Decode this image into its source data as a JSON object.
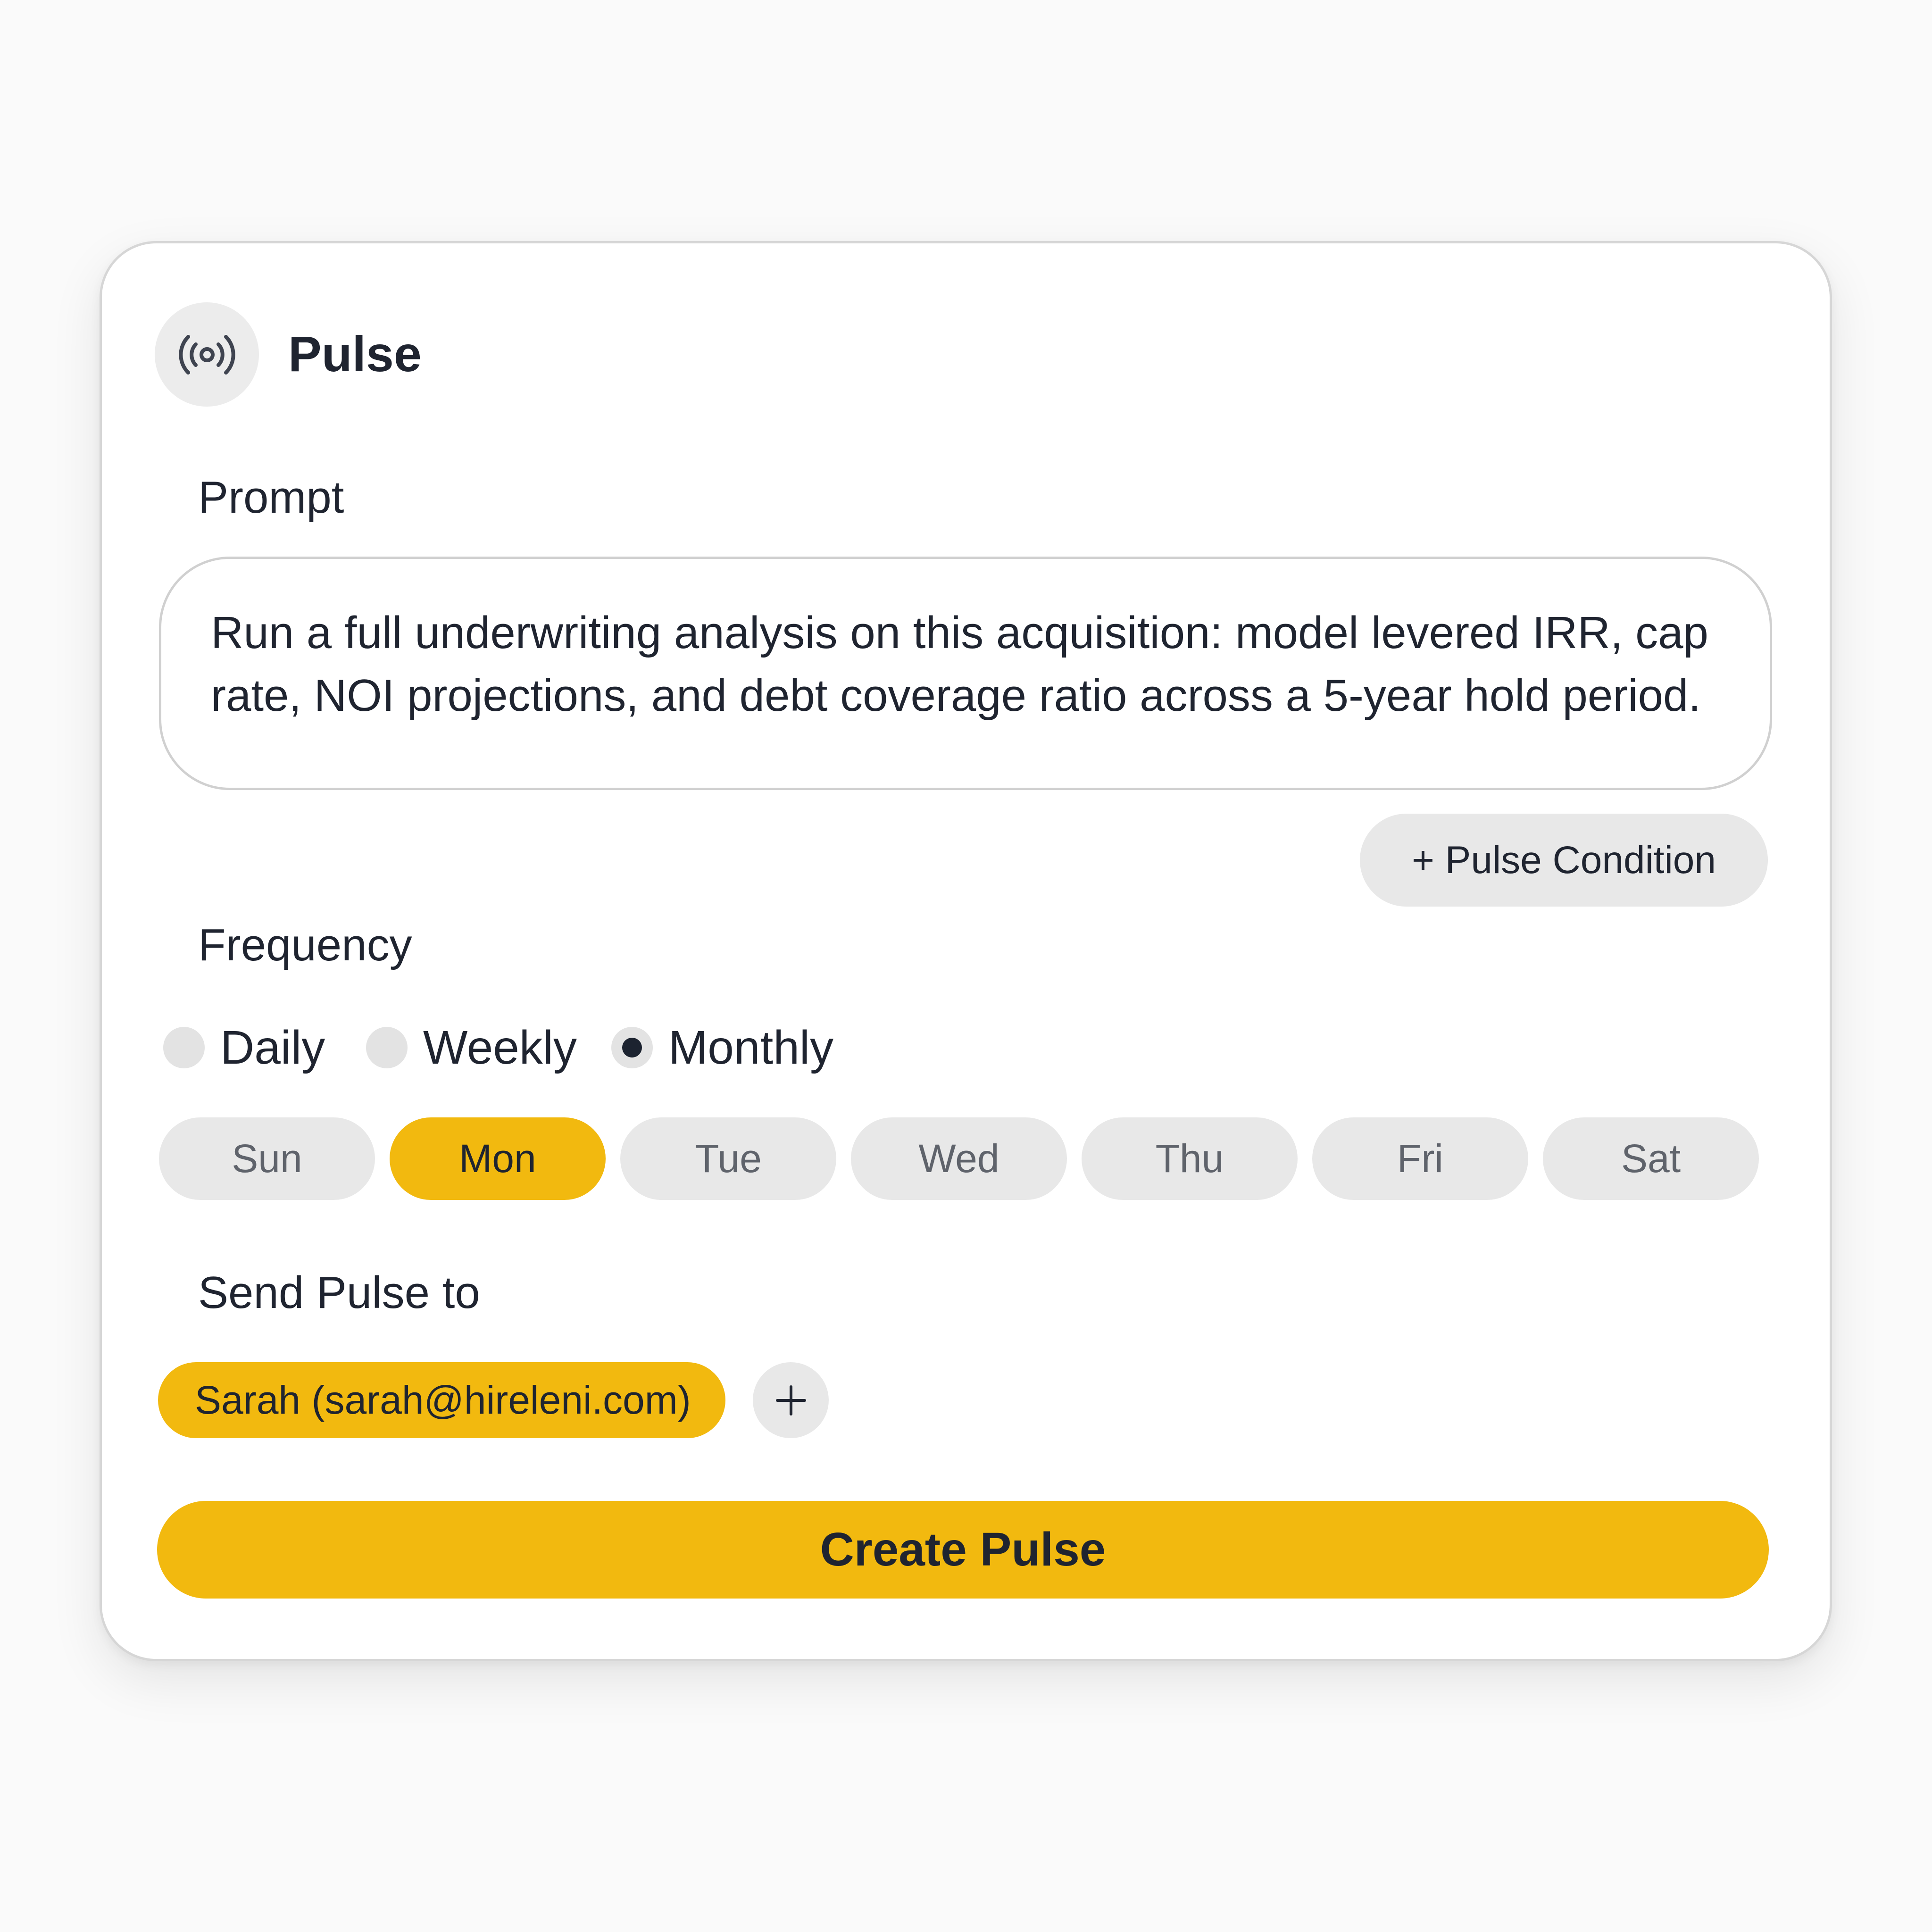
{
  "header": {
    "title": "Pulse",
    "icon": "broadcast-icon"
  },
  "prompt": {
    "label": "Prompt",
    "value": "Run a full underwriting analysis on this acquisition: model levered IRR, cap rate, NOI projections, and debt coverage ratio across a 5-year hold period."
  },
  "condition_button": {
    "label": "+ Pulse Condition"
  },
  "frequency": {
    "label": "Frequency",
    "options": [
      {
        "label": "Daily",
        "selected": false
      },
      {
        "label": "Weekly",
        "selected": false
      },
      {
        "label": "Monthly",
        "selected": true
      }
    ],
    "days": [
      {
        "label": "Sun",
        "selected": false
      },
      {
        "label": "Mon",
        "selected": true
      },
      {
        "label": "Tue",
        "selected": false
      },
      {
        "label": "Wed",
        "selected": false
      },
      {
        "label": "Thu",
        "selected": false
      },
      {
        "label": "Fri",
        "selected": false
      },
      {
        "label": "Sat",
        "selected": false
      }
    ]
  },
  "send_to": {
    "label": "Send Pulse to",
    "recipients": [
      {
        "label": "Sarah (sarah@hireleni.com)"
      }
    ],
    "add_icon": "plus-icon"
  },
  "create_button": {
    "label": "Create Pulse"
  },
  "colors": {
    "accent": "#f2b90f",
    "chip_background": "#e8e8e8",
    "text": "#1f2430",
    "card_border": "#d6d6d6"
  }
}
